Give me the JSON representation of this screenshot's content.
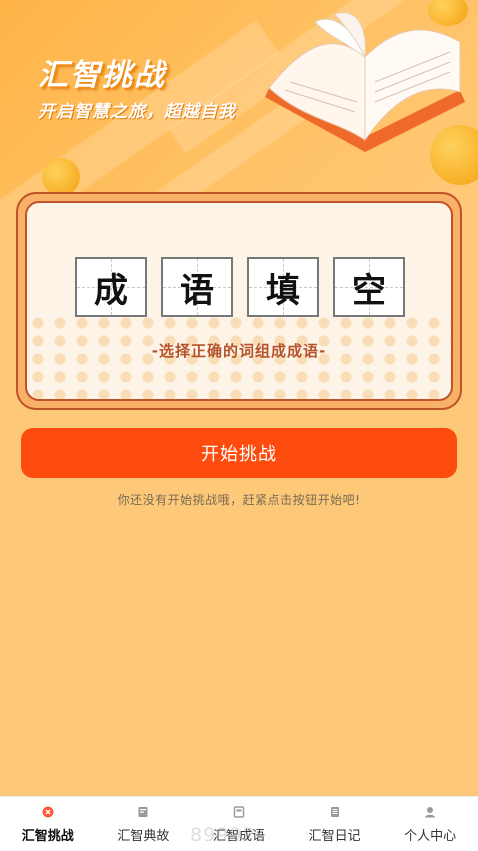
{
  "hero": {
    "title": "汇智挑战",
    "subtitle": "开启智慧之旅，超越自我"
  },
  "card": {
    "tiles": [
      "成",
      "语",
      "填",
      "空"
    ],
    "caption": "-选择正确的词组成成语-"
  },
  "start_button_label": "开始挑战",
  "hint": "你还没有开始挑战哦，赶紧点击按钮开始吧!",
  "watermark": "8999P",
  "tabbar": {
    "items": [
      {
        "label": "汇智挑战",
        "icon": "challenge-icon",
        "active": true
      },
      {
        "label": "汇智典故",
        "icon": "book-icon",
        "active": false
      },
      {
        "label": "汇智成语",
        "icon": "idiom-icon",
        "active": false
      },
      {
        "label": "汇智日记",
        "icon": "diary-icon",
        "active": false
      },
      {
        "label": "个人中心",
        "icon": "person-icon",
        "active": false
      }
    ]
  },
  "colors": {
    "accent": "#fd4c0d",
    "background": "#fdc878",
    "card_border": "#c0522a",
    "caption": "#b5542a"
  }
}
